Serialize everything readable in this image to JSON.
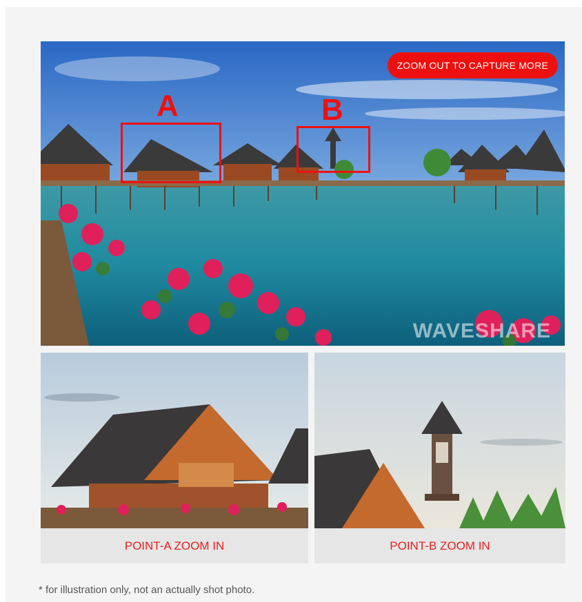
{
  "main_image": {
    "badge_label": "ZOOM OUT TO CAPTURE MORE",
    "marker_a_label": "A",
    "marker_b_label": "B",
    "watermark": "WAVESHARE",
    "marker_color": "#ee1010"
  },
  "panels": [
    {
      "caption": "POINT-A ZOOM IN"
    },
    {
      "caption": "POINT-B ZOOM IN"
    }
  ],
  "footnote": "* for illustration only, not an actually shot photo.",
  "colors": {
    "accent": "#ee1010",
    "caption_text": "#e52020",
    "panel_bg": "#e6e6e6"
  }
}
